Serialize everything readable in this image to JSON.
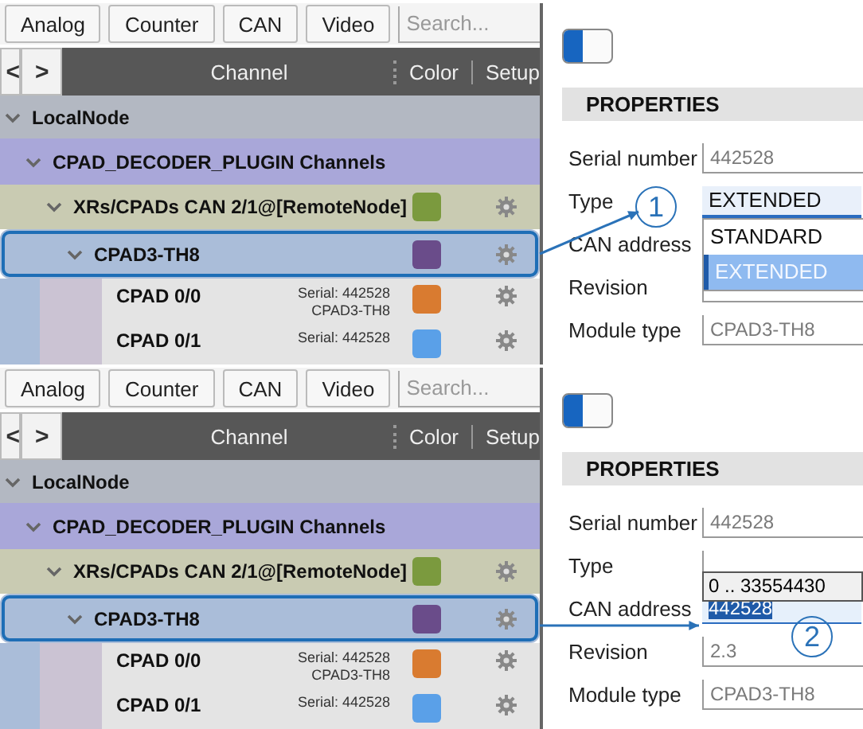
{
  "panels": [
    {
      "toolbar": {
        "buttons": [
          "Analog",
          "Counter",
          "CAN",
          "Video"
        ],
        "search": {
          "placeholder": "Search..."
        }
      },
      "header": {
        "nav": [
          "<",
          ">"
        ],
        "columns": [
          "Channel",
          "Color",
          "Setup"
        ]
      },
      "tree": [
        {
          "label": "LocalNode",
          "expanded": true,
          "selected": false,
          "children": [
            {
              "label": "CPAD_DECODER_PLUGIN Channels",
              "expanded": true,
              "selected": false,
              "children": [
                {
                  "label": "XRs/CPADs CAN 2/1@[RemoteNode]",
                  "color": "#7b9a3e",
                  "expanded": true,
                  "selected": false,
                  "children": [
                    {
                      "label": "CPAD3-TH8",
                      "color": "#6a4c8a",
                      "expanded": true,
                      "selected": true,
                      "children": [
                        {
                          "label": "CPAD 0/0",
                          "serial": "Serial: 442528",
                          "module": "CPAD3-TH8",
                          "color": "#d97b30",
                          "selected": false
                        },
                        {
                          "label": "CPAD 0/1",
                          "serial": "Serial: 442528",
                          "color": "#5aa0e8",
                          "selected": false
                        }
                      ]
                    }
                  ]
                }
              ]
            }
          ]
        }
      ],
      "toggle": {
        "on": true
      },
      "properties": {
        "title": "PROPERTIES",
        "fields": [
          {
            "label": "Serial number",
            "kind": "readonly",
            "value": "442528"
          },
          {
            "label": "Type",
            "kind": "dropdown",
            "value": "EXTENDED",
            "open": true,
            "options": [
              {
                "label": "STANDARD",
                "selected": false
              },
              {
                "label": "EXTENDED",
                "selected": true
              }
            ],
            "callout": {
              "number": "1",
              "kind": "beside-label"
            }
          },
          {
            "label": "CAN address",
            "kind": "label"
          },
          {
            "label": "Revision",
            "kind": "readonly"
          },
          {
            "label": "Module type",
            "kind": "readonly",
            "value": "CPAD3-TH8"
          }
        ]
      }
    },
    {
      "toolbar": {
        "buttons": [
          "Analog",
          "Counter",
          "CAN",
          "Video"
        ],
        "search": {
          "placeholder": "Search..."
        }
      },
      "header": {
        "nav": [
          "<",
          ">"
        ],
        "columns": [
          "Channel",
          "Color",
          "Setup"
        ]
      },
      "tree": [
        {
          "label": "LocalNode",
          "expanded": true,
          "selected": false,
          "children": [
            {
              "label": "CPAD_DECODER_PLUGIN Channels",
              "expanded": true,
              "selected": false,
              "children": [
                {
                  "label": "XRs/CPADs CAN 2/1@[RemoteNode]",
                  "color": "#7b9a3e",
                  "expanded": true,
                  "selected": false,
                  "children": [
                    {
                      "label": "CPAD3-TH8",
                      "color": "#6a4c8a",
                      "expanded": true,
                      "selected": true,
                      "children": [
                        {
                          "label": "CPAD 0/0",
                          "serial": "Serial: 442528",
                          "module": "CPAD3-TH8",
                          "color": "#d97b30",
                          "selected": false
                        },
                        {
                          "label": "CPAD 0/1",
                          "serial": "Serial: 442528",
                          "color": "#5aa0e8",
                          "selected": false
                        }
                      ]
                    }
                  ]
                }
              ]
            }
          ]
        }
      ],
      "toggle": {
        "on": true
      },
      "properties": {
        "title": "PROPERTIES",
        "fields": [
          {
            "label": "Serial number",
            "kind": "readonly",
            "value": "442528"
          },
          {
            "label": "Type",
            "kind": "dropdown",
            "open": false
          },
          {
            "label": "CAN address",
            "kind": "input",
            "value": "442528",
            "text_selected": true,
            "tooltip": "0 .. 33554430",
            "callout": {
              "number": "2",
              "kind": "below-value"
            }
          },
          {
            "label": "Revision",
            "kind": "readonly",
            "value": "2.3"
          },
          {
            "label": "Module type",
            "kind": "readonly",
            "value": "CPAD3-TH8"
          }
        ]
      }
    }
  ]
}
